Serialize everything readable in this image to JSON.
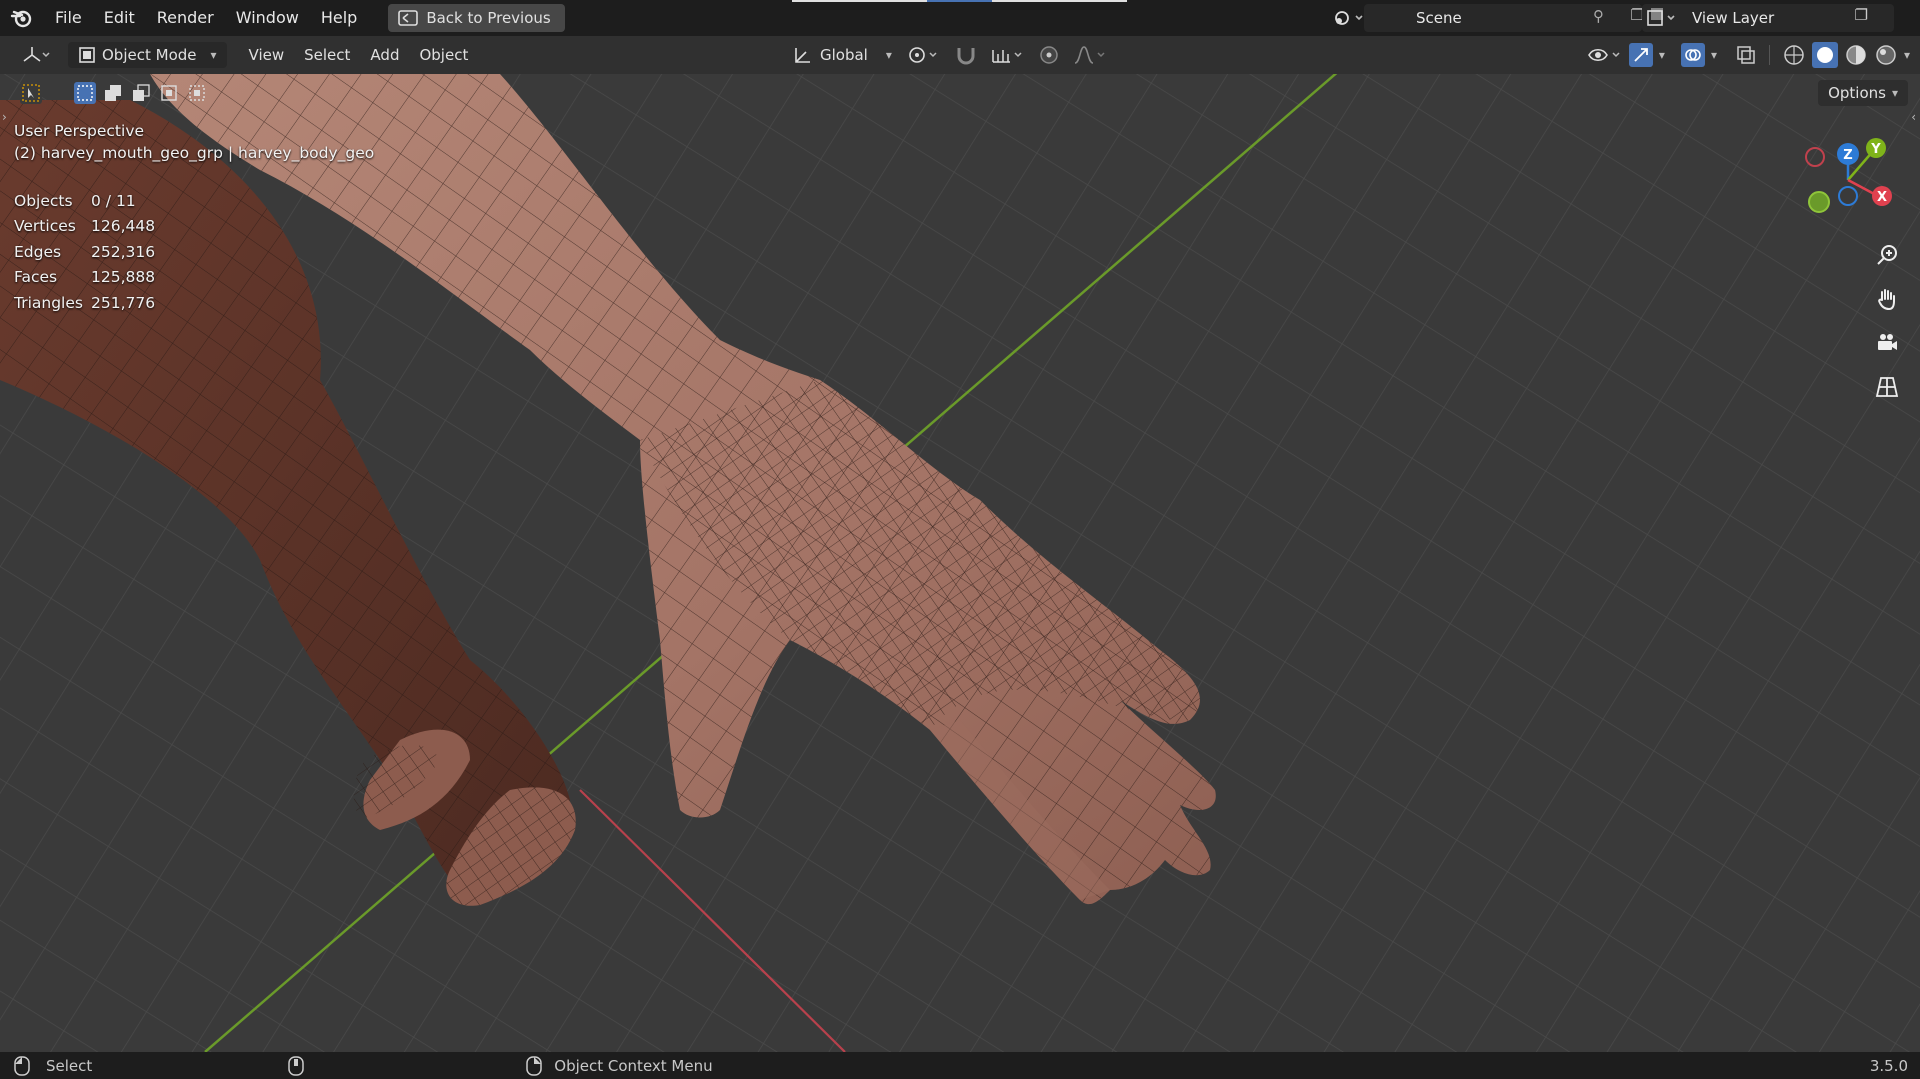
{
  "menubar": {
    "items": [
      "File",
      "Edit",
      "Render",
      "Window",
      "Help"
    ],
    "back_button": "Back to Previous",
    "scene_label": "Scene",
    "view_layer_label": "View Layer"
  },
  "header": {
    "mode": "Object Mode",
    "menus": [
      "View",
      "Select",
      "Add",
      "Object"
    ],
    "orientation": "Global",
    "options_label": "Options"
  },
  "viewport": {
    "perspective": "User Perspective",
    "active_object": "(2) harvey_mouth_geo_grp | harvey_body_geo",
    "stats": [
      {
        "label": "Objects",
        "value": "0 / 11"
      },
      {
        "label": "Vertices",
        "value": "126,448"
      },
      {
        "label": "Edges",
        "value": "252,316"
      },
      {
        "label": "Faces",
        "value": "125,888"
      },
      {
        "label": "Triangles",
        "value": "251,776"
      }
    ],
    "gizmo_axes": [
      "Z",
      "Y",
      "X"
    ]
  },
  "statusbar": {
    "select": "Select",
    "context_menu": "Object Context Menu",
    "version": "3.5.0"
  },
  "colors": {
    "x_axis": "#e0414f",
    "y_axis": "#7fb31a",
    "z_axis": "#2d7bd6",
    "skin": "#a8776a"
  }
}
